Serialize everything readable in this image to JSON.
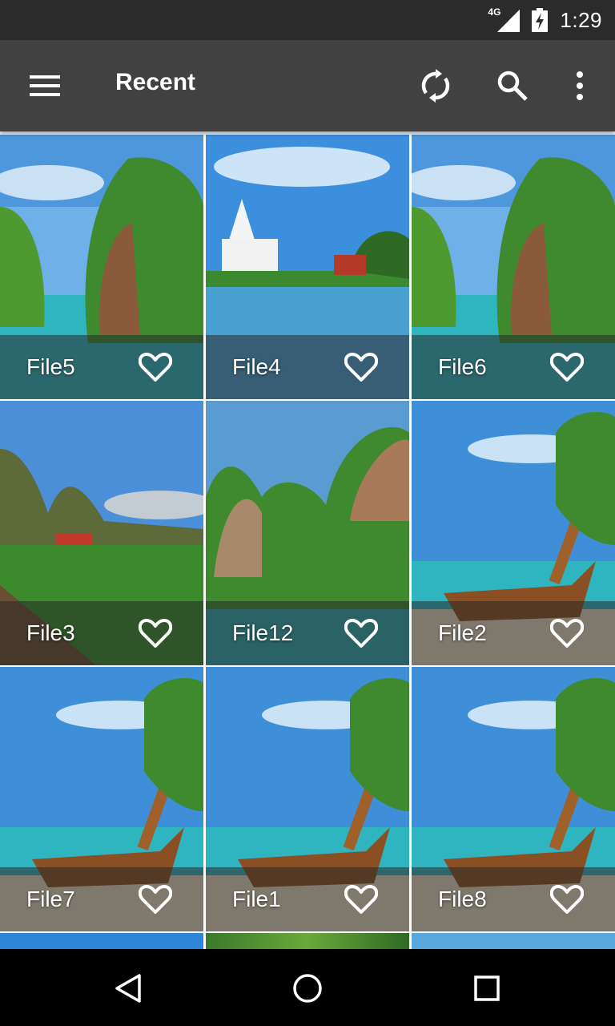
{
  "status_bar": {
    "network": "4G",
    "time": "1:29"
  },
  "toolbar": {
    "title": "Recent",
    "icons": [
      "menu-icon",
      "sync-icon",
      "search-icon",
      "more-vert-icon"
    ]
  },
  "files": [
    {
      "name": "File5",
      "scene": "island",
      "favorite": false
    },
    {
      "name": "File4",
      "scene": "temple",
      "favorite": false
    },
    {
      "name": "File6",
      "scene": "island",
      "favorite": false
    },
    {
      "name": "File3",
      "scene": "marsh",
      "favorite": false
    },
    {
      "name": "File12",
      "scene": "cliffs",
      "favorite": false
    },
    {
      "name": "File2",
      "scene": "boat",
      "favorite": false
    },
    {
      "name": "File7",
      "scene": "boat",
      "favorite": false
    },
    {
      "name": "File1",
      "scene": "boat",
      "favorite": false
    },
    {
      "name": "File8",
      "scene": "boat",
      "favorite": false
    }
  ],
  "nav_bar": {
    "icons": [
      "back-icon",
      "home-icon",
      "recents-icon"
    ]
  },
  "colors": {
    "status_bar": "#2b2b2b",
    "toolbar": "#414141",
    "caption_overlay": "rgba(40,40,40,0.55)",
    "sky": "#3f8fd8",
    "sea": "#2fb5c0",
    "foliage": "#3f8a2e"
  }
}
